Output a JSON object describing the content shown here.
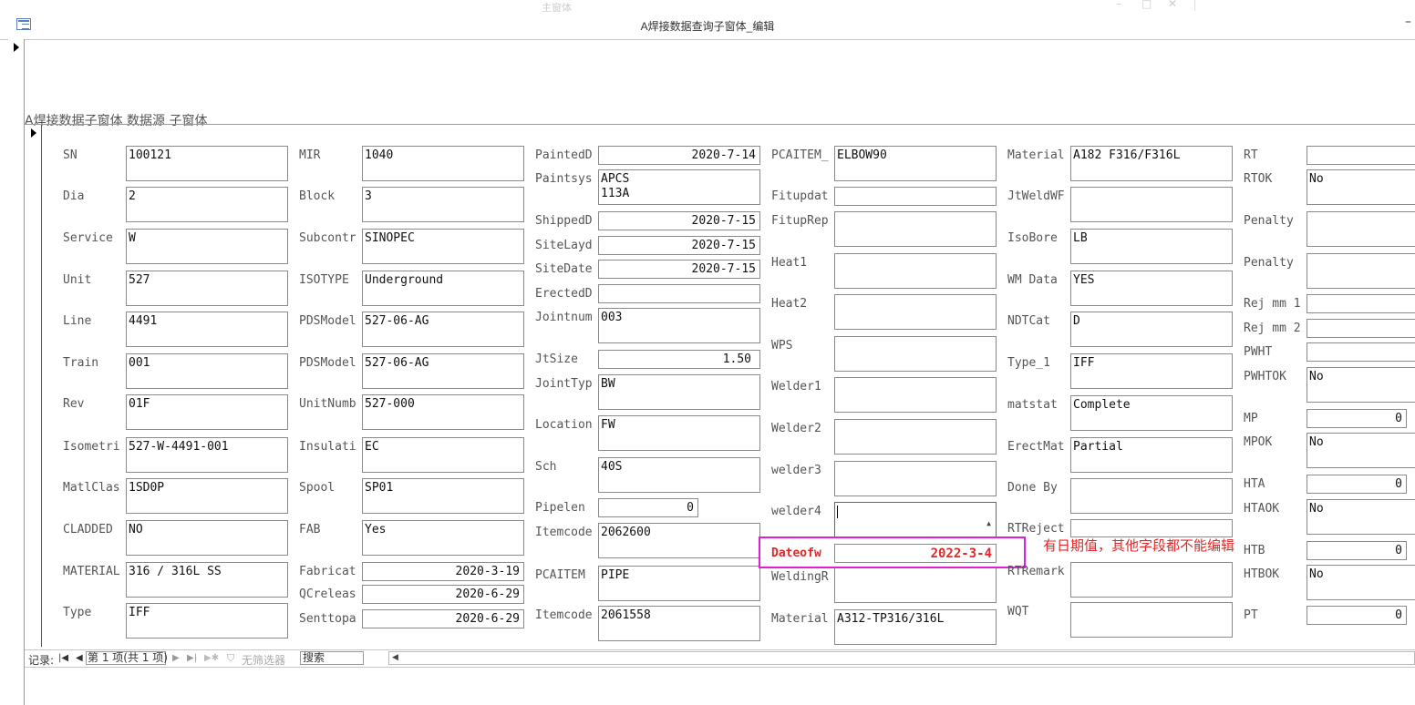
{
  "window": {
    "background_title": "主窗体",
    "title": "A焊接数据查询子窗体_编辑",
    "subform_caption": "A焊接数据子窗体 数据源 子窗体"
  },
  "annotation": {
    "note": "有日期值，其他字段都不能编辑",
    "color": "#e02828",
    "highlight_color": "#e020d0"
  },
  "fields": {
    "sn": {
      "label": "SN",
      "value": "100121"
    },
    "dia": {
      "label": "Dia",
      "value": "2"
    },
    "service": {
      "label": "Service",
      "value": "W"
    },
    "unit": {
      "label": "Unit",
      "value": "527"
    },
    "line": {
      "label": "Line",
      "value": "4491"
    },
    "train": {
      "label": "Train",
      "value": "001"
    },
    "rev": {
      "label": "Rev",
      "value": "01F"
    },
    "isometri": {
      "label": "Isometri",
      "value": "527-W-4491-001"
    },
    "matlclas": {
      "label": "MatlClas",
      "value": "1SD0P"
    },
    "cladded": {
      "label": "CLADDED",
      "value": "NO"
    },
    "material1": {
      "label": "MATERIAL",
      "value": "316 / 316L SS"
    },
    "type": {
      "label": "Type",
      "value": "IFF"
    },
    "mir": {
      "label": "MIR",
      "value": "1040"
    },
    "block": {
      "label": "Block",
      "value": "3"
    },
    "subcontr": {
      "label": "Subcontr",
      "value": "SINOPEC"
    },
    "isotype": {
      "label": "ISOTYPE",
      "value": "Underground"
    },
    "pdsmodel1": {
      "label": "PDSModel",
      "value": "527-06-AG"
    },
    "pdsmodel2": {
      "label": "PDSModel",
      "value": "527-06-AG"
    },
    "unitnumb": {
      "label": "UnitNumb",
      "value": "527-000"
    },
    "insulati": {
      "label": "Insulati",
      "value": "EC"
    },
    "spool": {
      "label": "Spool",
      "value": "SP01"
    },
    "fab": {
      "label": "FAB",
      "value": "Yes"
    },
    "fabricat": {
      "label": "Fabricat",
      "value": "2020-3-19"
    },
    "qcreleas": {
      "label": "QCreleas",
      "value": "2020-6-29"
    },
    "senttopa": {
      "label": "Senttopa",
      "value": "2020-6-29"
    },
    "paintedd": {
      "label": "PaintedD",
      "value": "2020-7-14"
    },
    "paintsys": {
      "label": "Paintsys",
      "value": "APCS\n113A"
    },
    "shippedd": {
      "label": "ShippedD",
      "value": "2020-7-15"
    },
    "sitelayd": {
      "label": "SiteLayd",
      "value": "2020-7-15"
    },
    "sitedate": {
      "label": "SiteDate",
      "value": "2020-7-15"
    },
    "erectedd": {
      "label": "ErectedD",
      "value": ""
    },
    "jointnum": {
      "label": "Jointnum",
      "value": "003"
    },
    "jtsize": {
      "label": "JtSize",
      "value": "1.50"
    },
    "jointtyp": {
      "label": "JointTyp",
      "value": "BW"
    },
    "location": {
      "label": "Location",
      "value": "FW"
    },
    "sch": {
      "label": "Sch",
      "value": "40S"
    },
    "pipelen": {
      "label": "Pipelen",
      "value": "0"
    },
    "itemcode1": {
      "label": "Itemcode",
      "value": "2062600"
    },
    "pcaitem2": {
      "label": "PCAITEM",
      "value": "PIPE"
    },
    "itemcode2": {
      "label": "Itemcode",
      "value": "2061558"
    },
    "pcaitem1": {
      "label": "PCAITEM_",
      "value": "ELBOW90"
    },
    "fitupdat": {
      "label": "Fitupdat",
      "value": ""
    },
    "fituprep": {
      "label": "FitupRep",
      "value": ""
    },
    "heat1": {
      "label": "Heat1",
      "value": ""
    },
    "heat2": {
      "label": "Heat2",
      "value": ""
    },
    "wps": {
      "label": "WPS",
      "value": ""
    },
    "welder1": {
      "label": "Welder1",
      "value": ""
    },
    "welder2": {
      "label": "Welder2",
      "value": ""
    },
    "welder3": {
      "label": "welder3",
      "value": ""
    },
    "welder4": {
      "label": "welder4",
      "value": ""
    },
    "dateofw": {
      "label": "Dateofw",
      "value": "2022-3-4"
    },
    "weldingr": {
      "label": "WeldingR",
      "value": ""
    },
    "material2": {
      "label": "Material",
      "value": "A312-TP316/316L"
    },
    "material3": {
      "label": "Material",
      "value": "A182 F316/F316L"
    },
    "jtweldwf": {
      "label": "JtWeldWF",
      "value": ""
    },
    "isobore": {
      "label": "IsoBore",
      "value": "LB"
    },
    "wmdata": {
      "label": "WM Data",
      "value": "YES"
    },
    "ndtcat": {
      "label": "NDTCat",
      "value": "D"
    },
    "type1": {
      "label": "Type_1",
      "value": "IFF"
    },
    "matstat": {
      "label": "matstat",
      "value": "Complete"
    },
    "erectmat": {
      "label": "ErectMat",
      "value": "Partial"
    },
    "doneby": {
      "label": "Done By",
      "value": ""
    },
    "rtreject": {
      "label": "RTReject",
      "value": ""
    },
    "rtremark": {
      "label": "RTRemark",
      "value": ""
    },
    "wqt": {
      "label": "WQT",
      "value": ""
    },
    "rt": {
      "label": "RT",
      "value": ""
    },
    "rtok": {
      "label": "RTOK",
      "value": "No"
    },
    "penalty1": {
      "label": "Penalty",
      "value": ""
    },
    "penalty2": {
      "label": "Penalty",
      "value": ""
    },
    "rejmm1": {
      "label": "Rej mm 1",
      "value": ""
    },
    "rejmm2": {
      "label": "Rej mm 2",
      "value": ""
    },
    "pwht": {
      "label": "PWHT",
      "value": ""
    },
    "pwhtok": {
      "label": "PWHTOK",
      "value": "No"
    },
    "mp": {
      "label": "MP",
      "value": "0"
    },
    "mpok": {
      "label": "MPOK",
      "value": "No"
    },
    "hta": {
      "label": "HTA",
      "value": "0"
    },
    "htaok": {
      "label": "HTAOK",
      "value": "No"
    },
    "htb": {
      "label": "HTB",
      "value": "0"
    },
    "htbok": {
      "label": "HTBOK",
      "value": "No"
    },
    "pt": {
      "label": "PT",
      "value": "0"
    }
  },
  "navbar": {
    "record_label": "记录:",
    "record_position": "第 1 项(共 1 项)",
    "filter": "无筛选器",
    "search": "搜索"
  }
}
